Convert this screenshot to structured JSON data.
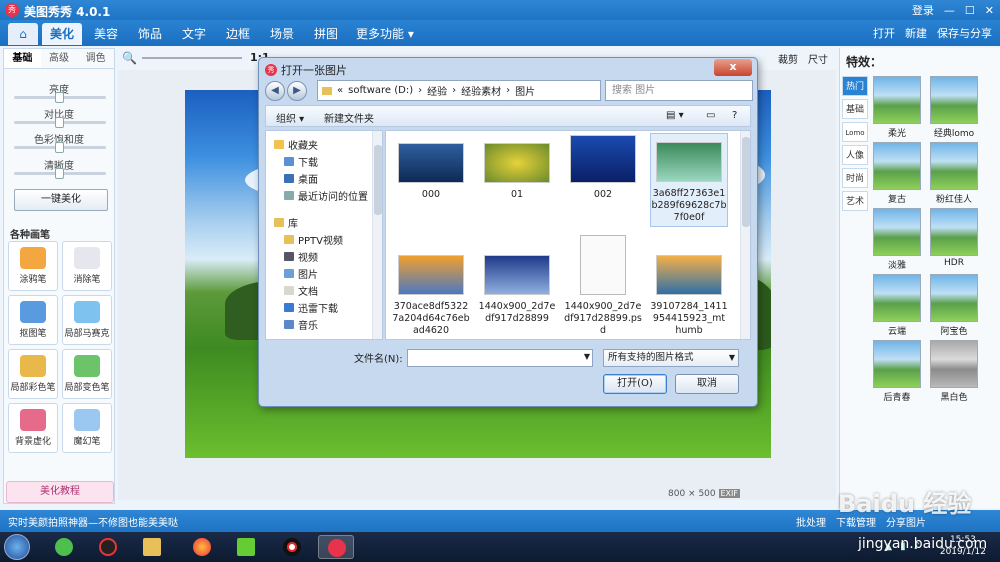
{
  "app": {
    "title": "美图秀秀 4.0.1",
    "logo": "秀",
    "login": "登录"
  },
  "menu": {
    "home_icon": "home-icon",
    "tabs": [
      "美化",
      "美容",
      "饰品",
      "文字",
      "边框",
      "场景",
      "拼图",
      "更多功能 ▾"
    ],
    "active_tab": "美化",
    "open": "打开",
    "new": "新建",
    "save": "保存与分享"
  },
  "left": {
    "subtabs": [
      "基础",
      "高级",
      "调色"
    ],
    "sliders": [
      {
        "label": "亮度",
        "value": 0.5
      },
      {
        "label": "对比度",
        "value": 0.5
      },
      {
        "label": "色彩饱和度",
        "value": 0.5
      },
      {
        "label": "清晰度",
        "value": 0.5
      }
    ],
    "one_key": "一键美化",
    "brush_header": "各种画笔",
    "tools": [
      "涂鸦笔",
      "消除笔",
      "抠图笔",
      "局部马赛克",
      "局部彩色笔",
      "局部变色笔",
      "背景虚化",
      "魔幻笔"
    ],
    "tutorial": "美化教程"
  },
  "toolbar": {
    "zoom": "1:1",
    "crop": "裁剪",
    "size": "尺寸"
  },
  "canvas": {
    "size": "800 × 500",
    "exif": "EXIF"
  },
  "right": {
    "title": "特效：",
    "tabs": [
      "热门",
      "基础",
      "Lomo",
      "人像",
      "时尚",
      "艺术"
    ],
    "effects": [
      "柔光",
      "经典lomo",
      "复古",
      "粉红佳人",
      "淡雅",
      "HDR",
      "云端",
      "阿宝色",
      "后青春",
      "黑白色"
    ]
  },
  "status": {
    "message": "实时美颜拍照神器—不修图也能美美哒",
    "batch": "批处理",
    "download": "下载管理",
    "share": "分享图片"
  },
  "dialog": {
    "title": "打开一张图片",
    "close": "x",
    "path": [
      "«",
      "software (D:)",
      "›",
      "经验",
      "›",
      "经验素材",
      "›",
      "图片"
    ],
    "search_placeholder": "搜索 图片",
    "organize": "组织 ▾",
    "new_folder": "新建文件夹",
    "nav": [
      "收藏夹",
      "下载",
      "桌面",
      "最近访问的位置",
      "库",
      "PPTV视频",
      "视频",
      "图片",
      "文档",
      "迅雷下载",
      "音乐"
    ],
    "files": [
      {
        "name": "000"
      },
      {
        "name": "01"
      },
      {
        "name": "002"
      },
      {
        "name": "3a68ff27363e1b289f69628c7b7f0e0f"
      },
      {
        "name": "370ace8df53227a204d64c76ebad4620"
      },
      {
        "name": "1440x900_2d7edf917d28899"
      },
      {
        "name": "1440x900_2d7edf917d28899.psd"
      },
      {
        "name": "39107284_1411954415923_mthumb"
      }
    ],
    "filename_label": "文件名(N):",
    "filename_value": "",
    "filetype": "所有支持的图片格式",
    "open_btn": "打开(O)",
    "cancel_btn": "取消"
  },
  "taskbar": {
    "time": "15:53",
    "date": "2019/1/12"
  },
  "watermark": {
    "text": "Baidu 经验",
    "sub": "jingyan.baidu.com"
  }
}
